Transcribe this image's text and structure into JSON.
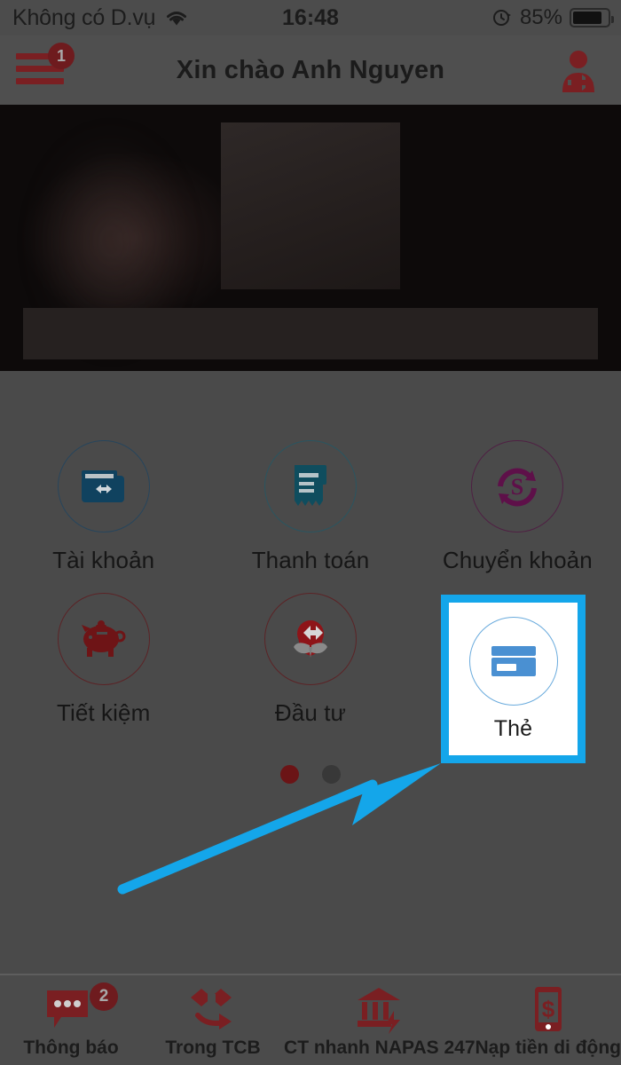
{
  "status_bar": {
    "carrier": "Không có D.vụ",
    "wifi_icon": "wifi-icon",
    "time": "16:48",
    "rotation_lock_icon": "rotation-lock-icon",
    "battery_percent": "85%",
    "battery_icon": "battery-icon"
  },
  "header": {
    "menu_icon": "hamburger-menu-icon",
    "menu_badge": "1",
    "title": "Xin chào Anh Nguyen",
    "logout_icon": "logout-user-icon"
  },
  "banner": {
    "name": "promo-banner"
  },
  "grid": {
    "items": [
      {
        "label": "Tài khoản",
        "icon": "wallet-icon",
        "color": "#0d3d5e"
      },
      {
        "label": "Thanh toán",
        "icon": "invoice-icon",
        "color": "#0e4d5e"
      },
      {
        "label": "Chuyển khoản",
        "icon": "money-transfer-icon",
        "color": "#5e1049"
      },
      {
        "label": "Tiết kiệm",
        "icon": "piggy-bank-icon",
        "color": "#6e1416"
      },
      {
        "label": "Đầu tư",
        "icon": "investment-growth-icon",
        "color": "#6e1416"
      },
      {
        "label": "Thẻ",
        "icon": "credit-card-icon",
        "color": "#4a90d2"
      }
    ],
    "highlight_label": "Thẻ",
    "highlight_color": "#14a6ea"
  },
  "pagination": {
    "active_index": 0,
    "total": 2,
    "active_color": "#6b1416",
    "inactive_color": "#383838"
  },
  "annotation": {
    "arrow_color": "#14a6ea",
    "points_to": "Thẻ"
  },
  "bottom_nav": {
    "items": [
      {
        "label": "Thông báo",
        "icon": "chat-bubble-icon",
        "badge": "2"
      },
      {
        "label": "Trong TCB",
        "icon": "techcombank-transfer-icon",
        "badge": ""
      },
      {
        "label": "CT nhanh NAPAS 247",
        "icon": "bank-lightning-icon",
        "badge": ""
      },
      {
        "label": "Nạp tiền di động",
        "icon": "phone-money-icon",
        "badge": ""
      }
    ]
  }
}
